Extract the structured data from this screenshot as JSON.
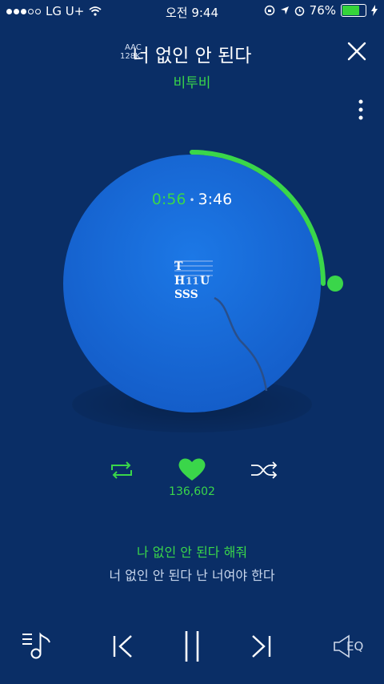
{
  "status_bar": {
    "carrier": "LG U+",
    "time": "오전 9:44",
    "battery_percent": "76%",
    "battery_level": 0.76
  },
  "track": {
    "title": "너 없인 안 된다",
    "artist": "비투비",
    "codec": "AAC",
    "bitrate": "128K",
    "elapsed": "0:56",
    "duration": "3:46",
    "progress": 0.25,
    "likes": "136,602"
  },
  "lyrics": {
    "current": "나 없인 안 된다 해줘",
    "next": "너 없인 안 된다 난 너여야 한다"
  },
  "bottom_bar": {
    "eq_label": "EQ"
  },
  "colors": {
    "background": "#0a2e66",
    "accent": "#3ad64a",
    "disc": "#1870e0"
  },
  "icons": [
    "wifi-icon",
    "lock-rotation-icon",
    "location-icon",
    "alarm-icon",
    "charging-icon",
    "close-icon",
    "more-vertical-icon",
    "repeat-icon",
    "heart-icon",
    "shuffle-icon",
    "playlist-icon",
    "previous-icon",
    "pause-icon",
    "next-icon",
    "speaker-eq-icon"
  ]
}
